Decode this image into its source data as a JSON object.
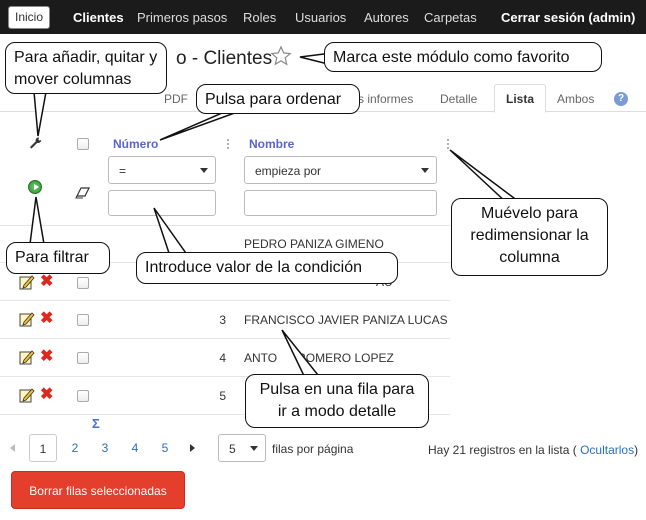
{
  "nav": {
    "home": "Inicio",
    "items": [
      "Clientes",
      "Primeros pasos",
      "Roles",
      "Usuarios",
      "Autores",
      "Carpetas"
    ],
    "logout": "Cerrar sesión (admin)"
  },
  "page": {
    "title_fragment": "o - Clientes"
  },
  "tabs": {
    "pdf": "PDF",
    "reports_fragment": "s informes",
    "detail": "Detalle",
    "list": "Lista",
    "both": "Ambos",
    "help": "?"
  },
  "table": {
    "columns": [
      "Número",
      "Nombre"
    ],
    "number_operator": "=",
    "name_operator": "empieza por",
    "rows": [
      {
        "number": "",
        "name": "PEDRO PANIZA GIMENO"
      },
      {
        "number": "",
        "name": "AU"
      },
      {
        "number": "3",
        "name": "FRANCISCO JAVIER PANIZA LUCAS"
      },
      {
        "number": "4",
        "name": "ANTO      ROMERO LOPEZ"
      },
      {
        "number": "5",
        "name": "F"
      }
    ]
  },
  "pager": {
    "sigma": "Σ",
    "pages": [
      "1",
      "2",
      "3",
      "4",
      "5"
    ],
    "current": "1",
    "rows_per_page": "5",
    "rows_label": "filas por página",
    "records_text": "Hay 21 registros en la lista (",
    "hide_link": "Ocultarlos",
    "records_close": ")"
  },
  "delete_button": "Borrar filas seleccionadas",
  "callouts": {
    "columns": "Para añadir, quitar y mover columnas",
    "favorite": "Marca este módulo como favorito",
    "sort": "Pulsa para ordenar",
    "filter": "Para filtrar",
    "condition": "Introduce valor de la condición",
    "resize": "Muévelo para redimensionar la columna",
    "detail": "Pulsa en una fila para ir a modo detalle"
  }
}
